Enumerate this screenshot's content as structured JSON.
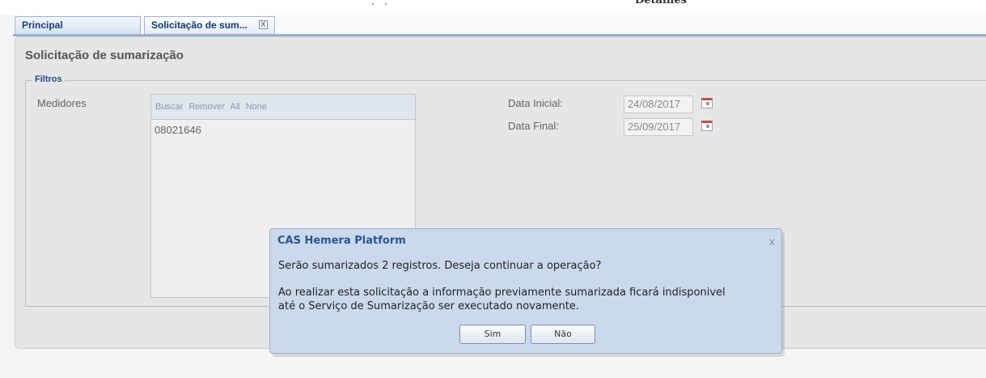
{
  "app": {
    "top_cut_label": "Detalhes"
  },
  "tabs": [
    {
      "label": "Principal"
    },
    {
      "label": "Solicitação de sum...",
      "close": "X"
    }
  ],
  "page": {
    "title": "Solicitação de sumarização",
    "fieldset_legend": "Filtros"
  },
  "filters": {
    "medidores_label": "Medidores",
    "list_actions": [
      "Buscar",
      "Remover",
      "All",
      "None"
    ],
    "items": [
      "08021646"
    ],
    "data_inicial_label": "Data Inicial:",
    "data_inicial_value": "24/08/2017",
    "data_final_label": "Data Final:",
    "data_final_value": "25/09/2017"
  },
  "dialog": {
    "title": "CAS Hemera Platform",
    "close": "x",
    "message1": "Serão sumarizados 2 registros. Deseja continuar a operação?",
    "message2_line1": "Ao realizar esta solicitação a informação previamente sumarizada ficará indisponivel",
    "message2_line2": "até o Serviço de Sumarização ser executado novamente.",
    "yes_label": "Sim",
    "no_label": "Não"
  },
  "icons": {
    "calendar": "calendar-icon",
    "close": "close-icon"
  }
}
